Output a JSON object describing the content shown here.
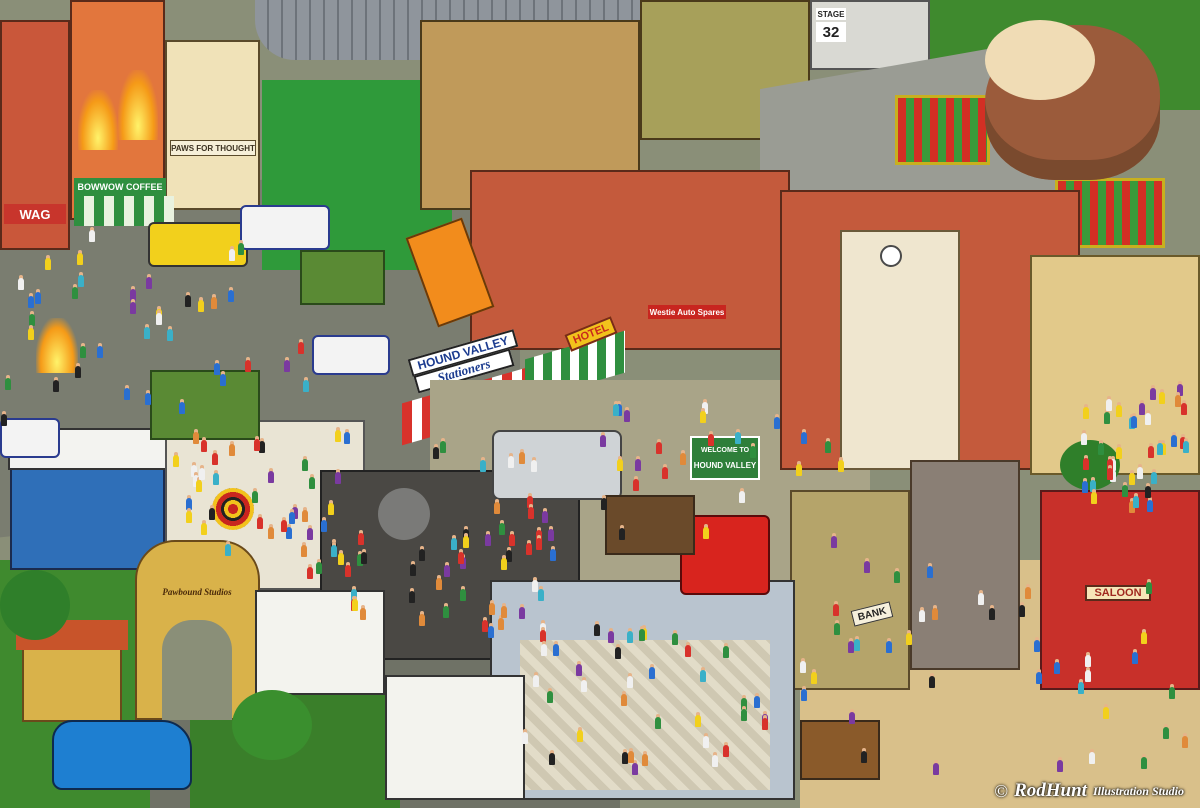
{
  "signs": {
    "wag": "WAG",
    "bowwow_coffee": "BOWWOW COFFEE",
    "paws_for_thought": "PAWS FOR THOUGHT",
    "stage": "STAGE",
    "stage_number": "32",
    "hound_valley": "HOUND VALLEY",
    "stationers": "Stationers",
    "hotel": "HOTEL",
    "westie_auto_spares": "Westie Auto Spares",
    "welcome_to": "WELCOME TO",
    "welcome_town": "HOUND VALLEY",
    "pawbound_studios": "Pawbound Studios",
    "bank": "BANK",
    "saloon": "SALOON"
  },
  "credit": {
    "copyright_symbol": "©",
    "name": "RodHunt",
    "studio": "Illustration Studio"
  },
  "colors": {
    "ground": "#8a8f78",
    "street": "#6f7266",
    "green_screen": "#2f9a3a",
    "brick": "#c9573a",
    "desert": "#d9c08a",
    "jungle": "#3f8a2e",
    "awning_red": "#d8322b",
    "taxi_yellow": "#f2d01c",
    "police_blue": "#2a3b8f"
  }
}
